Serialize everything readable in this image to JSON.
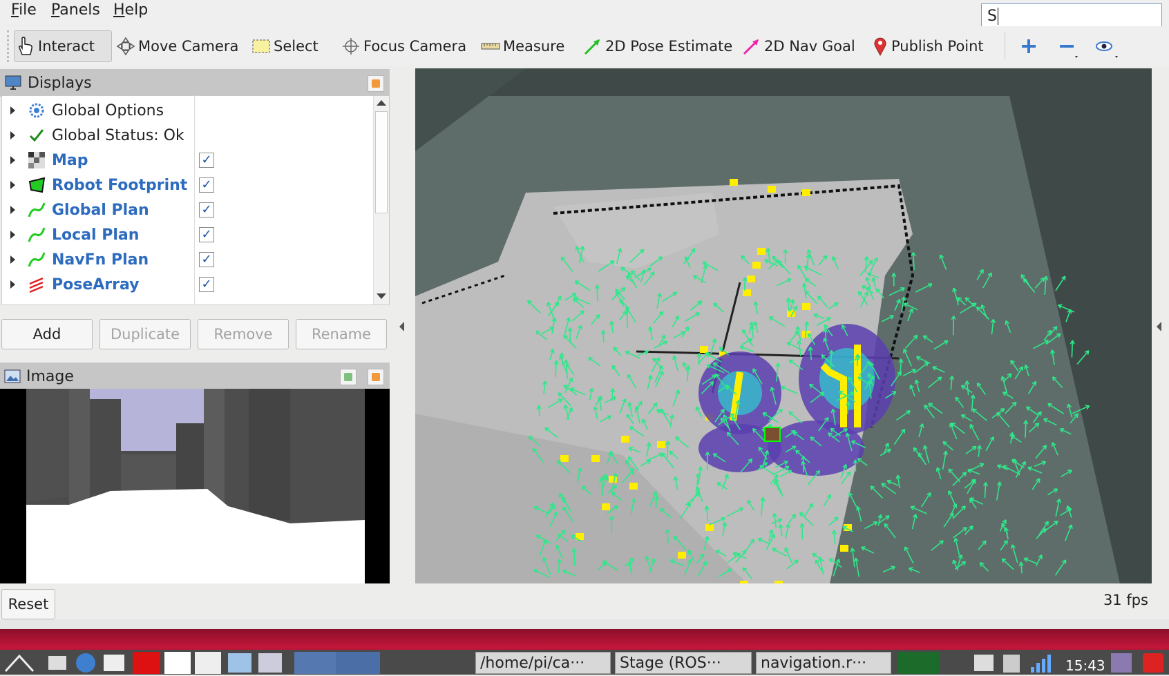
{
  "menu": {
    "file": "File",
    "panels": "Panels",
    "help": "Help"
  },
  "search": {
    "value": "S"
  },
  "toolbar": {
    "interact": "Interact",
    "move_camera": "Move Camera",
    "select": "Select",
    "focus_camera": "Focus Camera",
    "measure": "Measure",
    "pose_estimate": "2D Pose Estimate",
    "nav_goal": "2D Nav Goal",
    "publish_point": "Publish Point"
  },
  "displays": {
    "title": "Displays",
    "items": [
      {
        "label": "Global Options",
        "icon": "gear-icon",
        "checked": null
      },
      {
        "label": "Global Status: Ok",
        "icon": "check-icon",
        "checked": null
      },
      {
        "label": "Map",
        "icon": "map-icon",
        "checked": true
      },
      {
        "label": "Robot Footprint",
        "icon": "footprint-icon",
        "checked": true
      },
      {
        "label": "Global Plan",
        "icon": "path-icon",
        "checked": true
      },
      {
        "label": "Local Plan",
        "icon": "path-icon",
        "checked": true
      },
      {
        "label": "NavFn Plan",
        "icon": "path-icon",
        "checked": true
      },
      {
        "label": "PoseArray",
        "icon": "posearray-icon",
        "checked": true
      }
    ],
    "check_mark": "✓",
    "buttons": {
      "add": "Add",
      "duplicate": "Duplicate",
      "remove": "Remove",
      "rename": "Rename"
    }
  },
  "image_panel": {
    "title": "Image"
  },
  "bottom": {
    "reset": "Reset",
    "fps": "31 fps"
  },
  "taskbar": {
    "tasks": [
      "/home/pi/ca···",
      "Stage (ROS···",
      "navigation.r···"
    ],
    "clock": "15:43"
  },
  "colors": {
    "accent_blue": "#2d6bbf",
    "plan_green": "#22cc22",
    "pose_arrow": "#2ee88a",
    "taskbar_red": "#b8123a"
  }
}
